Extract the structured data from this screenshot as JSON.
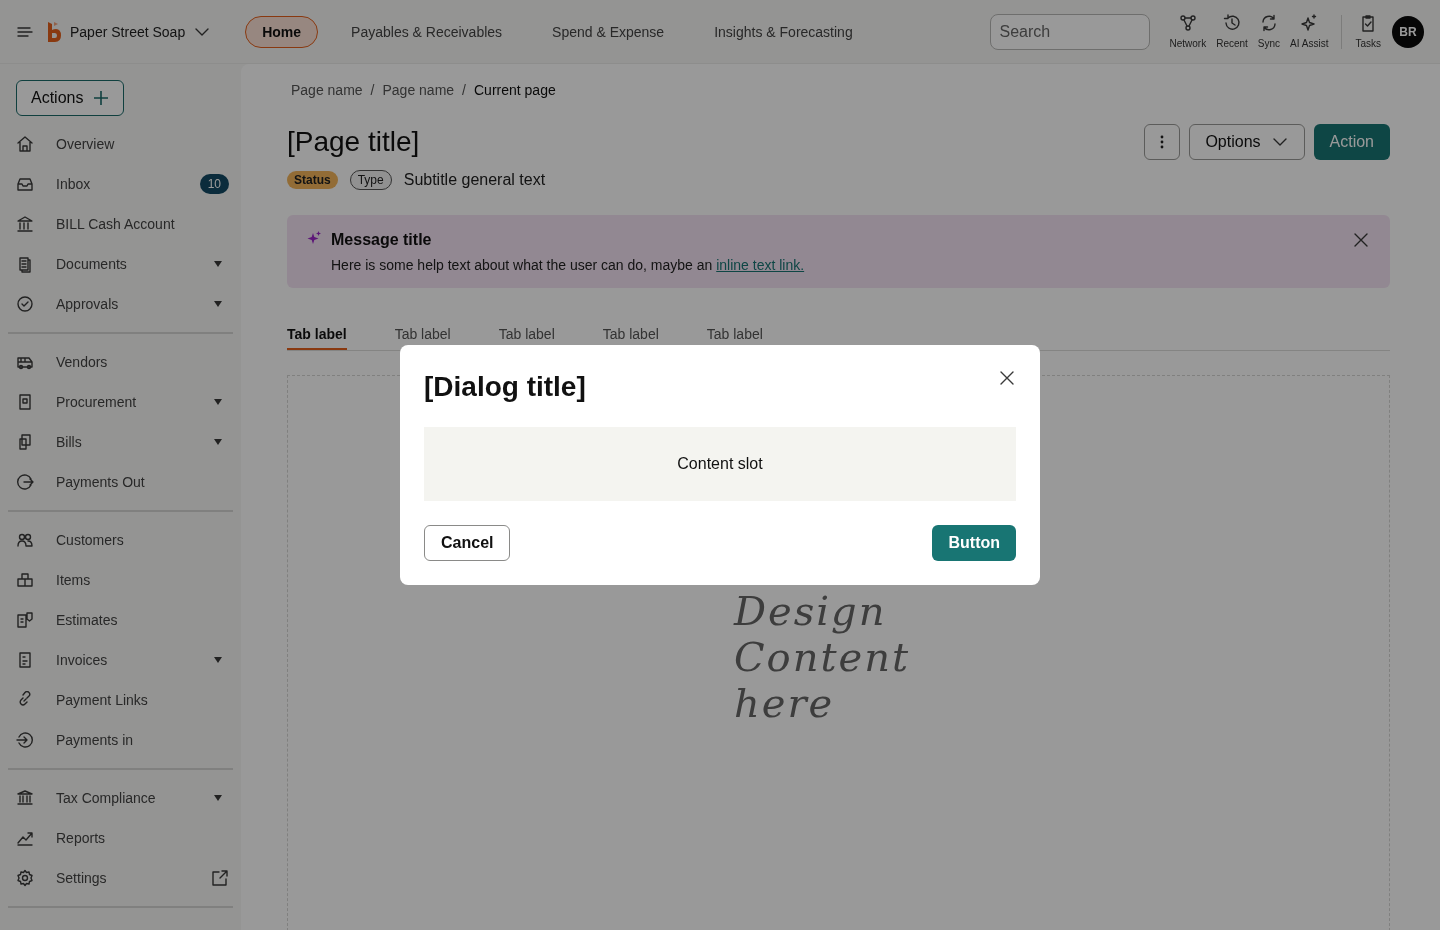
{
  "header": {
    "company": "Paper Street Soap",
    "nav": [
      {
        "label": "Home",
        "selected": true
      },
      {
        "label": "Payables & Receivables",
        "selected": false
      },
      {
        "label": "Spend & Expense",
        "selected": false
      },
      {
        "label": "Insights & Forecasting",
        "selected": false
      }
    ],
    "search": {
      "placeholder": "Search"
    },
    "tools": [
      {
        "label": "Network"
      },
      {
        "label": "Recent"
      },
      {
        "label": "Sync"
      },
      {
        "label": "AI Assist"
      }
    ],
    "tasks": {
      "label": "Tasks"
    },
    "avatar": "BR"
  },
  "sidebar": {
    "actions_button": "Actions",
    "groups": [
      [
        {
          "label": "Overview"
        },
        {
          "label": "Inbox",
          "badge": "10"
        },
        {
          "label": "BILL Cash Account"
        },
        {
          "label": "Documents",
          "has_submenu": true
        },
        {
          "label": "Approvals",
          "has_submenu": true
        }
      ],
      [
        {
          "label": "Vendors"
        },
        {
          "label": "Procurement",
          "has_submenu": true
        },
        {
          "label": "Bills",
          "has_submenu": true
        },
        {
          "label": "Payments Out"
        }
      ],
      [
        {
          "label": "Customers"
        },
        {
          "label": "Items"
        },
        {
          "label": "Estimates"
        },
        {
          "label": "Invoices",
          "has_submenu": true
        },
        {
          "label": "Payment Links"
        },
        {
          "label": "Payments in"
        }
      ],
      [
        {
          "label": "Tax Compliance",
          "has_submenu": true
        },
        {
          "label": "Reports"
        },
        {
          "label": "Settings",
          "external": true
        }
      ]
    ]
  },
  "main": {
    "breadcrumbs": [
      {
        "kind": "link",
        "text": "Page name"
      },
      {
        "kind": "separator",
        "text": "/"
      },
      {
        "kind": "link",
        "text": "Page name"
      },
      {
        "kind": "separator",
        "text": "/"
      },
      {
        "kind": "current",
        "text": "Current page"
      }
    ],
    "title": "[Page title]",
    "tags": [
      {
        "label": "Status",
        "kind": "status"
      },
      {
        "label": "Type",
        "kind": "type"
      }
    ],
    "subtitle": "Subtitle general text",
    "options_button": "Options",
    "action_button": "Action",
    "message": {
      "title": "Message title",
      "text": "Here is some help text about what the user can do, maybe an",
      "link": "inline text link."
    },
    "tabs": [
      {
        "label": "Tab label",
        "selected": true
      },
      {
        "label": "Tab label",
        "selected": false
      },
      {
        "label": "Tab label",
        "selected": false
      },
      {
        "label": "Tab label",
        "selected": false
      },
      {
        "label": "Tab label",
        "selected": false
      }
    ],
    "placeholder_lines": [
      "Design",
      "Content",
      "here"
    ]
  },
  "dialog": {
    "title": "[Dialog title]",
    "content": "Content slot",
    "cancel_button": "Cancel",
    "primary_button": "Button"
  }
}
